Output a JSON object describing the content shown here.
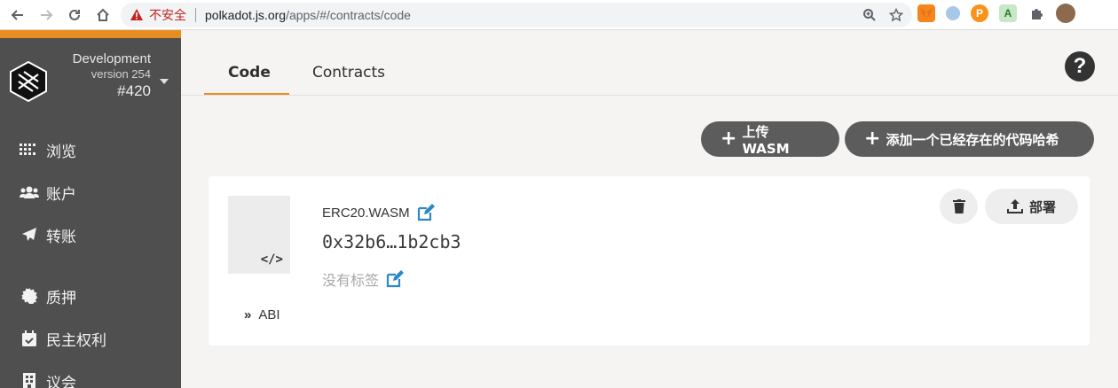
{
  "browser": {
    "security_label": "不安全",
    "url_host": "polkadot.js.org",
    "url_path": "/apps/#/contracts/code"
  },
  "sidebar": {
    "chain_name": "Development",
    "chain_version": "version 254",
    "block_number": "#420",
    "items": [
      {
        "label": "浏览",
        "icon": "grid-dots-icon"
      },
      {
        "label": "账户",
        "icon": "users-icon"
      },
      {
        "label": "转账",
        "icon": "paper-plane-icon"
      },
      {
        "label": "质押",
        "icon": "certificate-icon"
      },
      {
        "label": "民主权利",
        "icon": "calendar-check-icon"
      },
      {
        "label": "议会",
        "icon": "building-icon"
      }
    ]
  },
  "tabs": [
    {
      "label": "Code",
      "active": true
    },
    {
      "label": "Contracts",
      "active": false
    }
  ],
  "actions": {
    "upload_wasm": "上传 WASM",
    "add_existing": "添加一个已经存在的代码哈希"
  },
  "code_card": {
    "name": "ERC20.WASM",
    "hash": "0x32b6…1b2cb3",
    "tags_placeholder": "没有标签",
    "abi_label": "ABI",
    "deploy_label": "部署"
  },
  "colors": {
    "accent": "#e98c22",
    "sidebar_bg": "#4f4f4f",
    "edit_icon": "#2e88c8"
  }
}
